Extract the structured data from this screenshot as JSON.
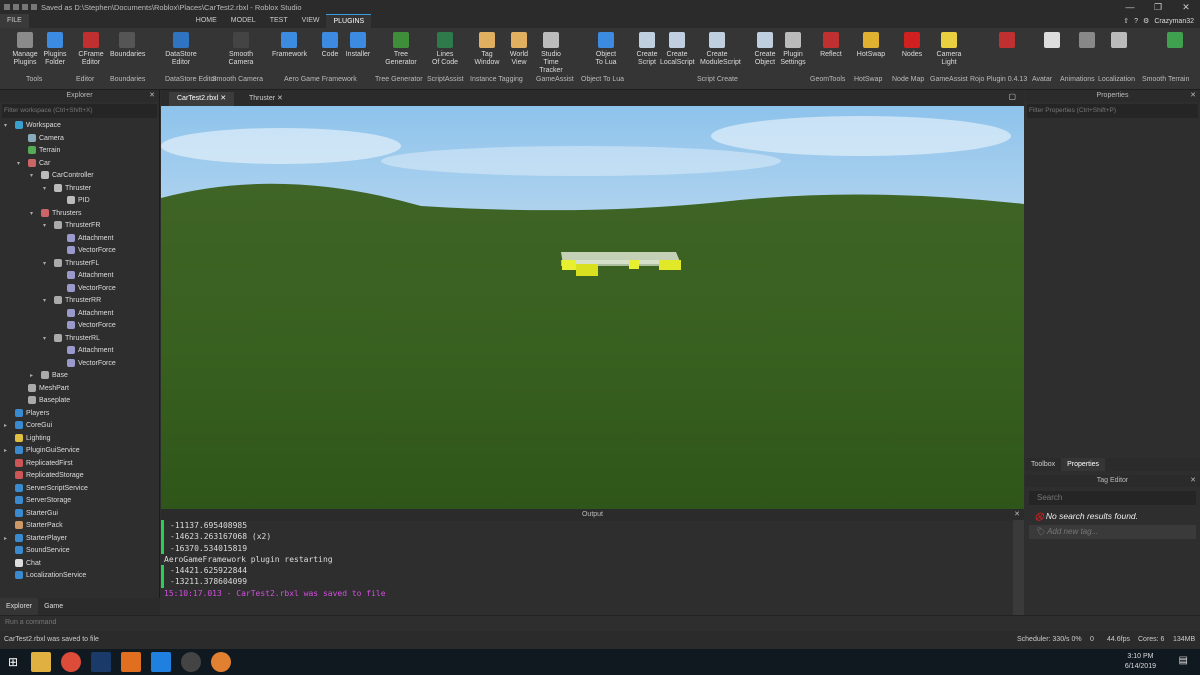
{
  "window": {
    "title": "Saved as D:\\Stephen\\Documents\\Roblox\\Places\\CarTest2.rbxl - Roblox Studio",
    "min": "—",
    "max": "❐",
    "close": "✕"
  },
  "menubar": {
    "items": [
      "FILE",
      "HOME",
      "MODEL",
      "TEST",
      "VIEW",
      "PLUGINS"
    ],
    "active": "PLUGINS",
    "username": "Crazyman32"
  },
  "ribbon": {
    "buttons": [
      {
        "label": "Manage\nPlugins",
        "color": "#8a8a8a"
      },
      {
        "label": "Plugins\nFolder",
        "color": "#3d8be0"
      },
      {
        "label": "CFrame\nEditor",
        "color": "#c03030"
      },
      {
        "label": "Boundaries",
        "color": "#555"
      },
      {
        "label": "DataStore\nEditor",
        "color": "#2f74c0"
      },
      {
        "label": "Smooth\nCamera",
        "color": "#444"
      },
      {
        "label": "Framework",
        "color": "#3d8be0"
      },
      {
        "label": "Code",
        "color": "#3d8be0"
      },
      {
        "label": "Installer",
        "color": "#3d8be0"
      },
      {
        "label": "Tree\nGenerator",
        "color": "#3f8f3a"
      },
      {
        "label": "Lines\nOf Code",
        "color": "#2f7a4a"
      },
      {
        "label": "Tag\nWindow",
        "color": "#e0b060"
      },
      {
        "label": "World\nView",
        "color": "#e0b060"
      },
      {
        "label": "Studio Time\nTracker",
        "color": "#bbb"
      },
      {
        "label": "Object\nTo Lua",
        "color": "#3d8be0"
      },
      {
        "label": "Create\nScript",
        "color": "#bfcfe0"
      },
      {
        "label": "Create\nLocalScript",
        "color": "#bfcfe0"
      },
      {
        "label": "Create\nModuleScript",
        "color": "#bfcfe0"
      },
      {
        "label": "Create\nObject",
        "color": "#bfcfe0"
      },
      {
        "label": "Plugin\nSettings",
        "color": "#bbb"
      },
      {
        "label": "Reflect",
        "color": "#c03030"
      },
      {
        "label": "HotSwap",
        "color": "#e0b030"
      },
      {
        "label": "Nodes",
        "color": "#d02020"
      },
      {
        "label": "Camera\nLight",
        "color": "#e8d040"
      },
      {
        "label": "",
        "color": "#c03030"
      },
      {
        "label": "",
        "color": "#ddd"
      },
      {
        "label": "",
        "color": "#888"
      },
      {
        "label": "",
        "color": "#bbb"
      },
      {
        "label": "",
        "color": "#3fa050"
      }
    ],
    "groups": [
      "Tools",
      "Editor",
      "Boundaries",
      "DataStore Editor",
      "Smooth Camera",
      "Aero Game Framework",
      "Tree Generator",
      "ScriptAssist",
      "Instance Tagging",
      "GameAssist",
      "Object To Lua",
      "Script Create",
      "GeomTools",
      "HotSwap",
      "Node Map",
      "GameAssist",
      "Rojo Plugin 0.4.13",
      "Avatar",
      "Animations",
      "Localization",
      "Smooth Terrain"
    ]
  },
  "explorer": {
    "title": "Explorer",
    "filter_placeholder": "Filter workspace (Ctrl+Shift+X)",
    "items": [
      {
        "label": "Workspace",
        "depth": 0,
        "arrow": "▾",
        "icon": "#3aa0d0"
      },
      {
        "label": "Camera",
        "depth": 1,
        "arrow": "",
        "icon": "#8ab"
      },
      {
        "label": "Terrain",
        "depth": 1,
        "arrow": "",
        "icon": "#5a5"
      },
      {
        "label": "Car",
        "depth": 1,
        "arrow": "▾",
        "icon": "#c66"
      },
      {
        "label": "CarController",
        "depth": 2,
        "arrow": "▾",
        "icon": "#bbb"
      },
      {
        "label": "Thruster",
        "depth": 3,
        "arrow": "▾",
        "icon": "#bbb"
      },
      {
        "label": "PID",
        "depth": 4,
        "arrow": "",
        "icon": "#bbb"
      },
      {
        "label": "Thrusters",
        "depth": 2,
        "arrow": "▾",
        "icon": "#c66"
      },
      {
        "label": "ThrusterFR",
        "depth": 3,
        "arrow": "▾",
        "icon": "#aaa"
      },
      {
        "label": "Attachment",
        "depth": 4,
        "arrow": "",
        "icon": "#99c"
      },
      {
        "label": "VectorForce",
        "depth": 4,
        "arrow": "",
        "icon": "#99c"
      },
      {
        "label": "ThrusterFL",
        "depth": 3,
        "arrow": "▾",
        "icon": "#aaa"
      },
      {
        "label": "Attachment",
        "depth": 4,
        "arrow": "",
        "icon": "#99c"
      },
      {
        "label": "VectorForce",
        "depth": 4,
        "arrow": "",
        "icon": "#99c"
      },
      {
        "label": "ThrusterRR",
        "depth": 3,
        "arrow": "▾",
        "icon": "#aaa"
      },
      {
        "label": "Attachment",
        "depth": 4,
        "arrow": "",
        "icon": "#99c"
      },
      {
        "label": "VectorForce",
        "depth": 4,
        "arrow": "",
        "icon": "#99c"
      },
      {
        "label": "ThrusterRL",
        "depth": 3,
        "arrow": "▾",
        "icon": "#aaa"
      },
      {
        "label": "Attachment",
        "depth": 4,
        "arrow": "",
        "icon": "#99c"
      },
      {
        "label": "VectorForce",
        "depth": 4,
        "arrow": "",
        "icon": "#99c"
      },
      {
        "label": "Base",
        "depth": 2,
        "arrow": "▸",
        "icon": "#aaa"
      },
      {
        "label": "MeshPart",
        "depth": 1,
        "arrow": "",
        "icon": "#aaa"
      },
      {
        "label": "Baseplate",
        "depth": 1,
        "arrow": "",
        "icon": "#aaa"
      },
      {
        "label": "Players",
        "depth": 0,
        "arrow": "",
        "icon": "#3a8ad0"
      },
      {
        "label": "CoreGui",
        "depth": 0,
        "arrow": "▸",
        "icon": "#3a8ad0"
      },
      {
        "label": "Lighting",
        "depth": 0,
        "arrow": "",
        "icon": "#e0c040"
      },
      {
        "label": "PluginGuiService",
        "depth": 0,
        "arrow": "▸",
        "icon": "#3a8ad0"
      },
      {
        "label": "ReplicatedFirst",
        "depth": 0,
        "arrow": "",
        "icon": "#c55"
      },
      {
        "label": "ReplicatedStorage",
        "depth": 0,
        "arrow": "",
        "icon": "#c55"
      },
      {
        "label": "ServerScriptService",
        "depth": 0,
        "arrow": "",
        "icon": "#3a8ad0"
      },
      {
        "label": "ServerStorage",
        "depth": 0,
        "arrow": "",
        "icon": "#3a8ad0"
      },
      {
        "label": "StarterGui",
        "depth": 0,
        "arrow": "",
        "icon": "#3a8ad0"
      },
      {
        "label": "StarterPack",
        "depth": 0,
        "arrow": "",
        "icon": "#c96"
      },
      {
        "label": "StarterPlayer",
        "depth": 0,
        "arrow": "▸",
        "icon": "#3a8ad0"
      },
      {
        "label": "SoundService",
        "depth": 0,
        "arrow": "",
        "icon": "#3a8ad0"
      },
      {
        "label": "Chat",
        "depth": 0,
        "arrow": "",
        "icon": "#ddd"
      },
      {
        "label": "LocalizationService",
        "depth": 0,
        "arrow": "",
        "icon": "#3a8ad0"
      }
    ],
    "tabs": [
      "Explorer",
      "Game"
    ]
  },
  "doc_tabs": [
    "CarTest2.rbxl",
    "Thruster"
  ],
  "output": {
    "title": "Output",
    "lines": [
      {
        "text": "-11137.695408985",
        "bar": true,
        "saved": false
      },
      {
        "text": "-14623.263167068 (x2)",
        "bar": true,
        "saved": false
      },
      {
        "text": "-16370.534015819",
        "bar": true,
        "saved": false
      },
      {
        "text": "AeroGameFramework plugin restarting",
        "bar": false,
        "saved": false
      },
      {
        "text": "-14421.625922844",
        "bar": true,
        "saved": false
      },
      {
        "text": "-13211.378604099",
        "bar": true,
        "saved": false
      },
      {
        "text": "15:10:17.013 - CarTest2.rbxl was saved to file",
        "bar": false,
        "saved": true
      }
    ]
  },
  "properties": {
    "title": "Properties",
    "filter_placeholder": "Filter Properties (Ctrl+Shift+P)",
    "tabs": [
      "Toolbox",
      "Properties"
    ]
  },
  "tag_editor": {
    "title": "Tag Editor",
    "search_placeholder": "Search",
    "no_results": "No search results found.",
    "add_tag": "Add new tag..."
  },
  "command_bar": {
    "placeholder": "Run a command"
  },
  "status": {
    "message": "CarTest2.rbxl was saved to file",
    "scheduler": "Scheduler: 330/s 0%",
    "t": "0",
    "fps": "44.6fps",
    "cores": "Cores: 6",
    "memory": "134MB"
  },
  "taskbar": {
    "time": "3:10 PM",
    "date": "6/14/2019"
  }
}
